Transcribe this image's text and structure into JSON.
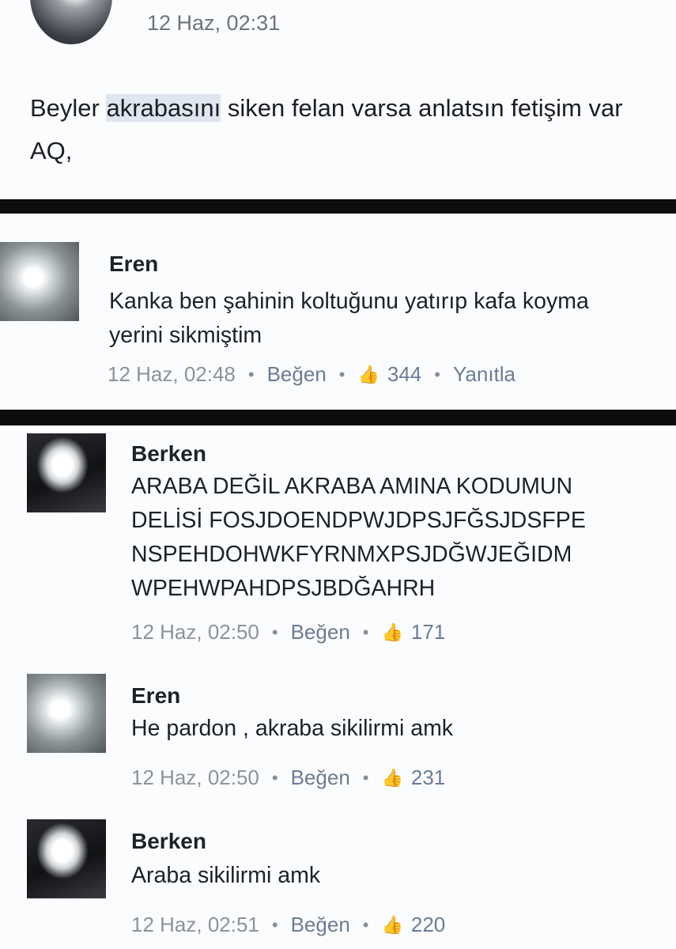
{
  "post": {
    "timestamp": "12 Haz, 02:31",
    "text_before": "Beyler ",
    "text_highlight": "akrabasını",
    "text_after": " siken felan varsa anlatsın fetişim var AQ,"
  },
  "comments": [
    {
      "name": "Eren",
      "text": "Kanka ben şahinin koltuğunu yatırıp kafa koyma yerini sikmiştim",
      "timestamp": "12 Haz, 02:48",
      "like_label": "Beğen",
      "like_count": "344",
      "reply_label": "Yanıtla"
    },
    {
      "name": "Berken",
      "text_lines": [
        "ARABA DEĞİL AKRABA AMINA KODUMUN",
        "DELİSİ FOSJDOENDPWJDPSJFĞSJDSFPE",
        "NSPEHDOHWKFYRNMXPSJDĞWJEĞIDM",
        "WPEHWPAHDPSJBDĞAHRH"
      ],
      "timestamp": "12 Haz, 02:50",
      "like_label": "Beğen",
      "like_count": "171"
    },
    {
      "name": "Eren",
      "text": "He pardon , akraba sikilirmi amk",
      "timestamp": "12 Haz, 02:50",
      "like_label": "Beğen",
      "like_count": "231"
    },
    {
      "name": "Berken",
      "text": "Araba sikilirmi amk",
      "timestamp": "12 Haz, 02:51",
      "like_label": "Beğen",
      "like_count": "220"
    }
  ],
  "icons": {
    "like": "thumbs-up-icon",
    "separator": "dot"
  },
  "colors": {
    "background": "#fbfcfd",
    "separator": "#0d0d0d",
    "meta_text": "#8a8d91",
    "action_text": "#6a7c95",
    "highlight": "#dfe6f0"
  }
}
